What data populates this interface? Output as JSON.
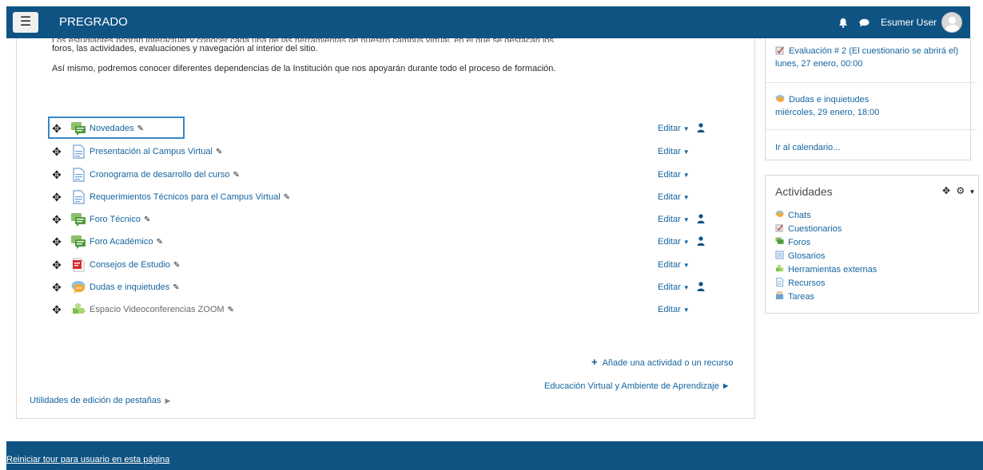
{
  "navbar": {
    "menu_icon": "hamburger-menu-icon",
    "brand": "PREGRADO",
    "user_name": "Esumer User",
    "icons": [
      "bell-icon",
      "chat-bubble-icon",
      "avatar"
    ],
    "bg_color": "#0f5383"
  },
  "intro": {
    "clipped_line": "Los estudiantes podrán interactuar y conocer cada una de las herramientas de nuestro campus virtual, en el que se destacan los",
    "line2": "foros, las actividades, evaluaciones y navegación al interior del sitio.",
    "para2": "Así mismo, podremos conocer diferentes dependencias de la Institución que nos apoyarán durante todo el proceso de formación."
  },
  "activities": [
    {
      "label": "Novedades",
      "icon": "forum-icon",
      "edit": "Editar",
      "has_group": true
    },
    {
      "label": "Presentación al Campus Virtual",
      "icon": "page-icon",
      "edit": "Editar",
      "has_group": false
    },
    {
      "label": "Cronograma de desarrollo del curso",
      "icon": "page-icon",
      "edit": "Editar",
      "has_group": false
    },
    {
      "label": "Requerimientos Técnicos para el Campus Virtual",
      "icon": "page-icon",
      "edit": "Editar",
      "has_group": false
    },
    {
      "label": "Foro Técnico",
      "icon": "forum-icon",
      "edit": "Editar",
      "has_group": true
    },
    {
      "label": "Foro Académico",
      "icon": "forum-icon",
      "edit": "Editar",
      "has_group": true
    },
    {
      "label": "Consejos de Estudio",
      "icon": "pdf-icon",
      "edit": "Editar",
      "has_group": false
    },
    {
      "label": "Dudas e inquietudes",
      "icon": "chat-icon",
      "edit": "Editar",
      "has_group": true
    },
    {
      "label": "Espacio Videoconferencias ZOOM",
      "icon": "puzzle-icon",
      "edit": "Editar",
      "has_group": false
    }
  ],
  "actions": {
    "add_activity": "Añade una actividad o un recurso",
    "next_section": "Educación Virtual y Ambiente de Aprendizaje",
    "tab_utils": "Utilidades de edición de pestañas"
  },
  "upcoming": {
    "events": [
      {
        "title": "Evaluación # 2 (El cuestionario se abrirá el)",
        "date": "lunes, 27 enero, 00:00",
        "icon": "quiz-icon"
      },
      {
        "title": "Dudas e inquietudes",
        "date": "miércoles, 29 enero, 18:00",
        "icon": "chat-icon"
      }
    ],
    "calendar_link": "Ir al calendario..."
  },
  "activities_block": {
    "title": "Actividades",
    "items": [
      {
        "label": "Chats",
        "icon": "chat-icon"
      },
      {
        "label": "Cuestionarios",
        "icon": "quiz-icon"
      },
      {
        "label": "Foros",
        "icon": "forum-icon"
      },
      {
        "label": "Glosarios",
        "icon": "glossary-icon"
      },
      {
        "label": "Herramientas externas",
        "icon": "puzzle-icon"
      },
      {
        "label": "Recursos",
        "icon": "page-icon"
      },
      {
        "label": "Tareas",
        "icon": "assignment-icon"
      }
    ]
  },
  "footer": {
    "tour_link": "Reiniciar tour para usuario en esta página"
  },
  "colors": {
    "primary": "#0f5383",
    "link": "#1565a0",
    "highlight_border": "#3a87c6"
  }
}
